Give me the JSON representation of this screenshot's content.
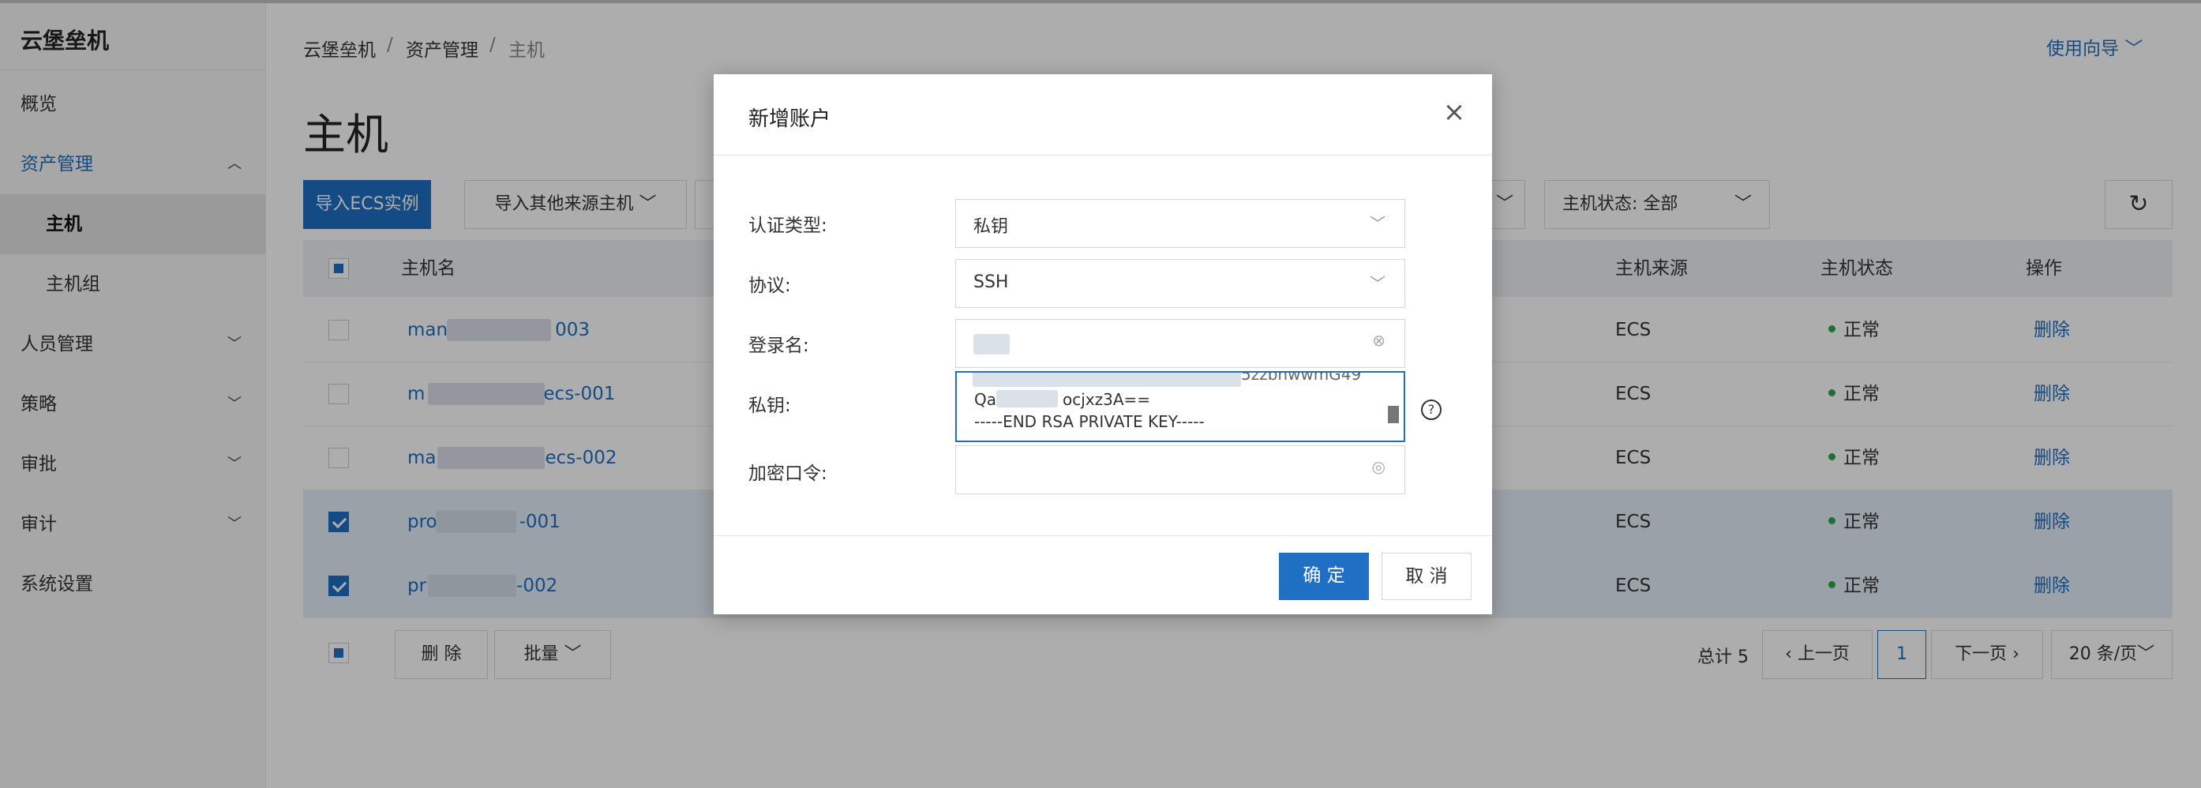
{
  "sidebar": {
    "brand": "云堡垒机",
    "items": [
      {
        "label": "概览"
      },
      {
        "label": "资产管理"
      },
      {
        "label": "主机"
      },
      {
        "label": "主机组"
      },
      {
        "label": "人员管理"
      },
      {
        "label": "策略"
      },
      {
        "label": "审批"
      },
      {
        "label": "审计"
      },
      {
        "label": "系统设置"
      }
    ]
  },
  "breadcrumb": [
    "云堡垒机",
    "资产管理",
    "主机"
  ],
  "guide_label": "使用向导",
  "page_title": "主机",
  "toolbar": {
    "import_ecs": "导入ECS实例",
    "import_other": "导入其他来源主机",
    "status_filter": "主机状态: 全部"
  },
  "table": {
    "columns": [
      "主机名",
      "主机来源",
      "主机状态",
      "操作"
    ],
    "rows": [
      {
        "name_prefix": "man",
        "name_suffix": "003",
        "source": "ECS",
        "status": "正常",
        "op": "删除",
        "checked": false
      },
      {
        "name_prefix": "m",
        "name_suffix": "ecs-001",
        "source": "ECS",
        "status": "正常",
        "op": "删除",
        "checked": false
      },
      {
        "name_prefix": "ma",
        "name_suffix": "ecs-002",
        "source": "ECS",
        "status": "正常",
        "op": "删除",
        "checked": false
      },
      {
        "name_prefix": "pro",
        "name_suffix": "-001",
        "source": "ECS",
        "status": "正常",
        "op": "删除",
        "checked": true
      },
      {
        "name_prefix": "pr",
        "name_suffix": "-002",
        "source": "ECS",
        "status": "正常",
        "op": "删除",
        "checked": true
      }
    ]
  },
  "footer": {
    "delete": "删 除",
    "batch": "批量",
    "total": "总计 5",
    "prev": "上一页",
    "page": "1",
    "next": "下一页",
    "page_size": "20 条/页"
  },
  "modal": {
    "title": "新增账户",
    "auth_label": "认证类型:",
    "auth_value": "私钥",
    "protocol_label": "协议:",
    "protocol_value": "SSH",
    "login_label": "登录名:",
    "key_label": "私钥:",
    "key_lines": [
      "5zzbnwwmG49",
      "Qa",
      "ocjxz3A==",
      "-----END RSA PRIVATE KEY-----"
    ],
    "passphrase_label": "加密口令:",
    "ok": "确 定",
    "cancel": "取 消"
  },
  "colors": {
    "accent": "#1f6fc5",
    "status_ok": "#2ea44f"
  }
}
